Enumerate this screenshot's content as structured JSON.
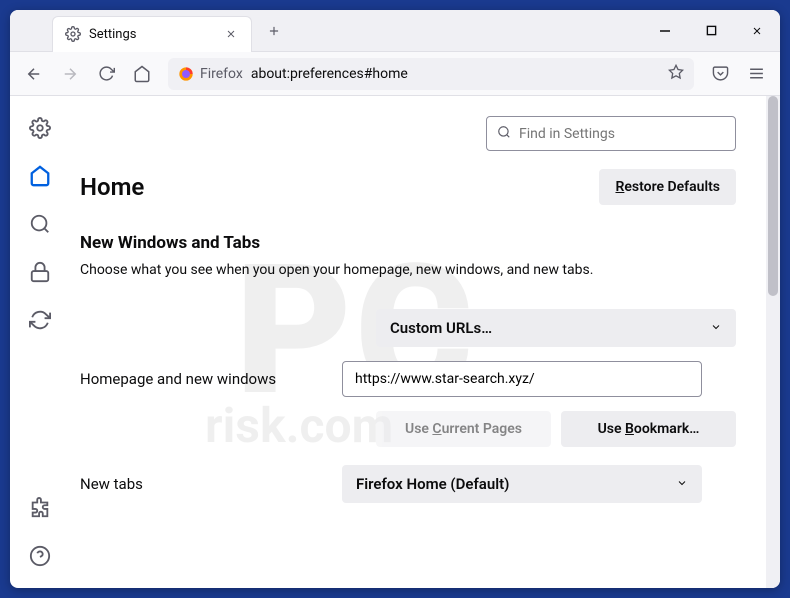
{
  "tab": {
    "title": "Settings"
  },
  "urlbar": {
    "label": "Firefox",
    "path": "about:preferences#home"
  },
  "search": {
    "placeholder": "Find in Settings"
  },
  "page": {
    "title": "Home",
    "restore_label": "Restore Defaults"
  },
  "section": {
    "title": "New Windows and Tabs",
    "desc": "Choose what you see when you open your homepage, new windows, and new tabs."
  },
  "homepage": {
    "label": "Homepage and new windows",
    "select": "Custom URLs…",
    "url": "https://www.star-search.xyz/",
    "use_current": "Use Current Pages",
    "use_bookmark": "Use Bookmark…"
  },
  "newtabs": {
    "label": "New tabs",
    "select": "Firefox Home (Default)"
  }
}
